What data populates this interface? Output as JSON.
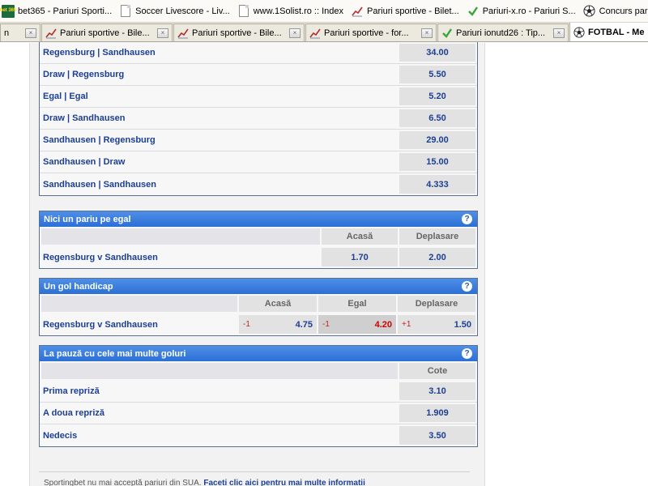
{
  "bookmarks": [
    {
      "label": "bet365 - Pariuri Sporti...",
      "icon": "bet365-icon"
    },
    {
      "label": "Soccer Livescore - Liv...",
      "icon": "page-icon"
    },
    {
      "label": "www.1Solist.ro :: Index",
      "icon": "page-icon"
    },
    {
      "label": "Pariuri sportive - Bilet...",
      "icon": "chart-icon"
    },
    {
      "label": "Pariuri-x.ro - Pariuri S...",
      "icon": "check-icon"
    },
    {
      "label": "Concurs pariu",
      "icon": "ball-icon"
    }
  ],
  "tabs": [
    {
      "label": "n",
      "icon": ""
    },
    {
      "label": "Pariuri sportive - Bile...",
      "icon": "chart-icon"
    },
    {
      "label": "Pariuri sportive - Bile...",
      "icon": "chart-icon"
    },
    {
      "label": "Pariuri sportive - for...",
      "icon": "chart-icon"
    },
    {
      "label": "Pariuri ionutd26 : Tip...",
      "icon": "check-icon"
    },
    {
      "label": "FOTBAL - Me",
      "icon": "ball-icon",
      "active": true
    }
  ],
  "bet_icon_text": "bet 365",
  "close_glyph": "×",
  "help_glyph": "?",
  "double_chance": {
    "rows": [
      {
        "name": "Regensburg | Sandhausen",
        "odd": "34.00"
      },
      {
        "name": "Draw | Regensburg",
        "odd": "5.50"
      },
      {
        "name": "Egal | Egal",
        "odd": "5.20"
      },
      {
        "name": "Draw | Sandhausen",
        "odd": "6.50"
      },
      {
        "name": "Sandhausen | Regensburg",
        "odd": "29.00"
      },
      {
        "name": "Sandhausen | Draw",
        "odd": "15.00"
      },
      {
        "name": "Sandhausen | Sandhausen",
        "odd": "4.333"
      }
    ]
  },
  "draw_no_bet": {
    "title": "Nici un pariu pe egal",
    "col_home": "Acasă",
    "col_away": "Deplasare",
    "match": "Regensburg v Sandhausen",
    "odd_home": "1.70",
    "odd_away": "2.00"
  },
  "handicap": {
    "title": "Un gol handicap",
    "col_home": "Acasă",
    "col_draw": "Egal",
    "col_away": "Deplasare",
    "match": "Regensburg v Sandhausen",
    "home_line": "-1",
    "home_odd": "4.75",
    "draw_line": "-1",
    "draw_odd": "4.20",
    "away_line": "+1",
    "away_odd": "1.50"
  },
  "half_goals": {
    "title": "La pauză cu cele mai multe goluri",
    "col_odds": "Cote",
    "rows": [
      {
        "name": "Prima repriză",
        "odd": "3.10"
      },
      {
        "name": "A doua repriză",
        "odd": "1.909"
      },
      {
        "name": "Nedecis",
        "odd": "3.50"
      }
    ]
  },
  "footer": {
    "text": "Sportingbet nu mai acceptă pariuri din SUA.",
    "link": "Faceti clic aici pentru mai multe informatii"
  }
}
